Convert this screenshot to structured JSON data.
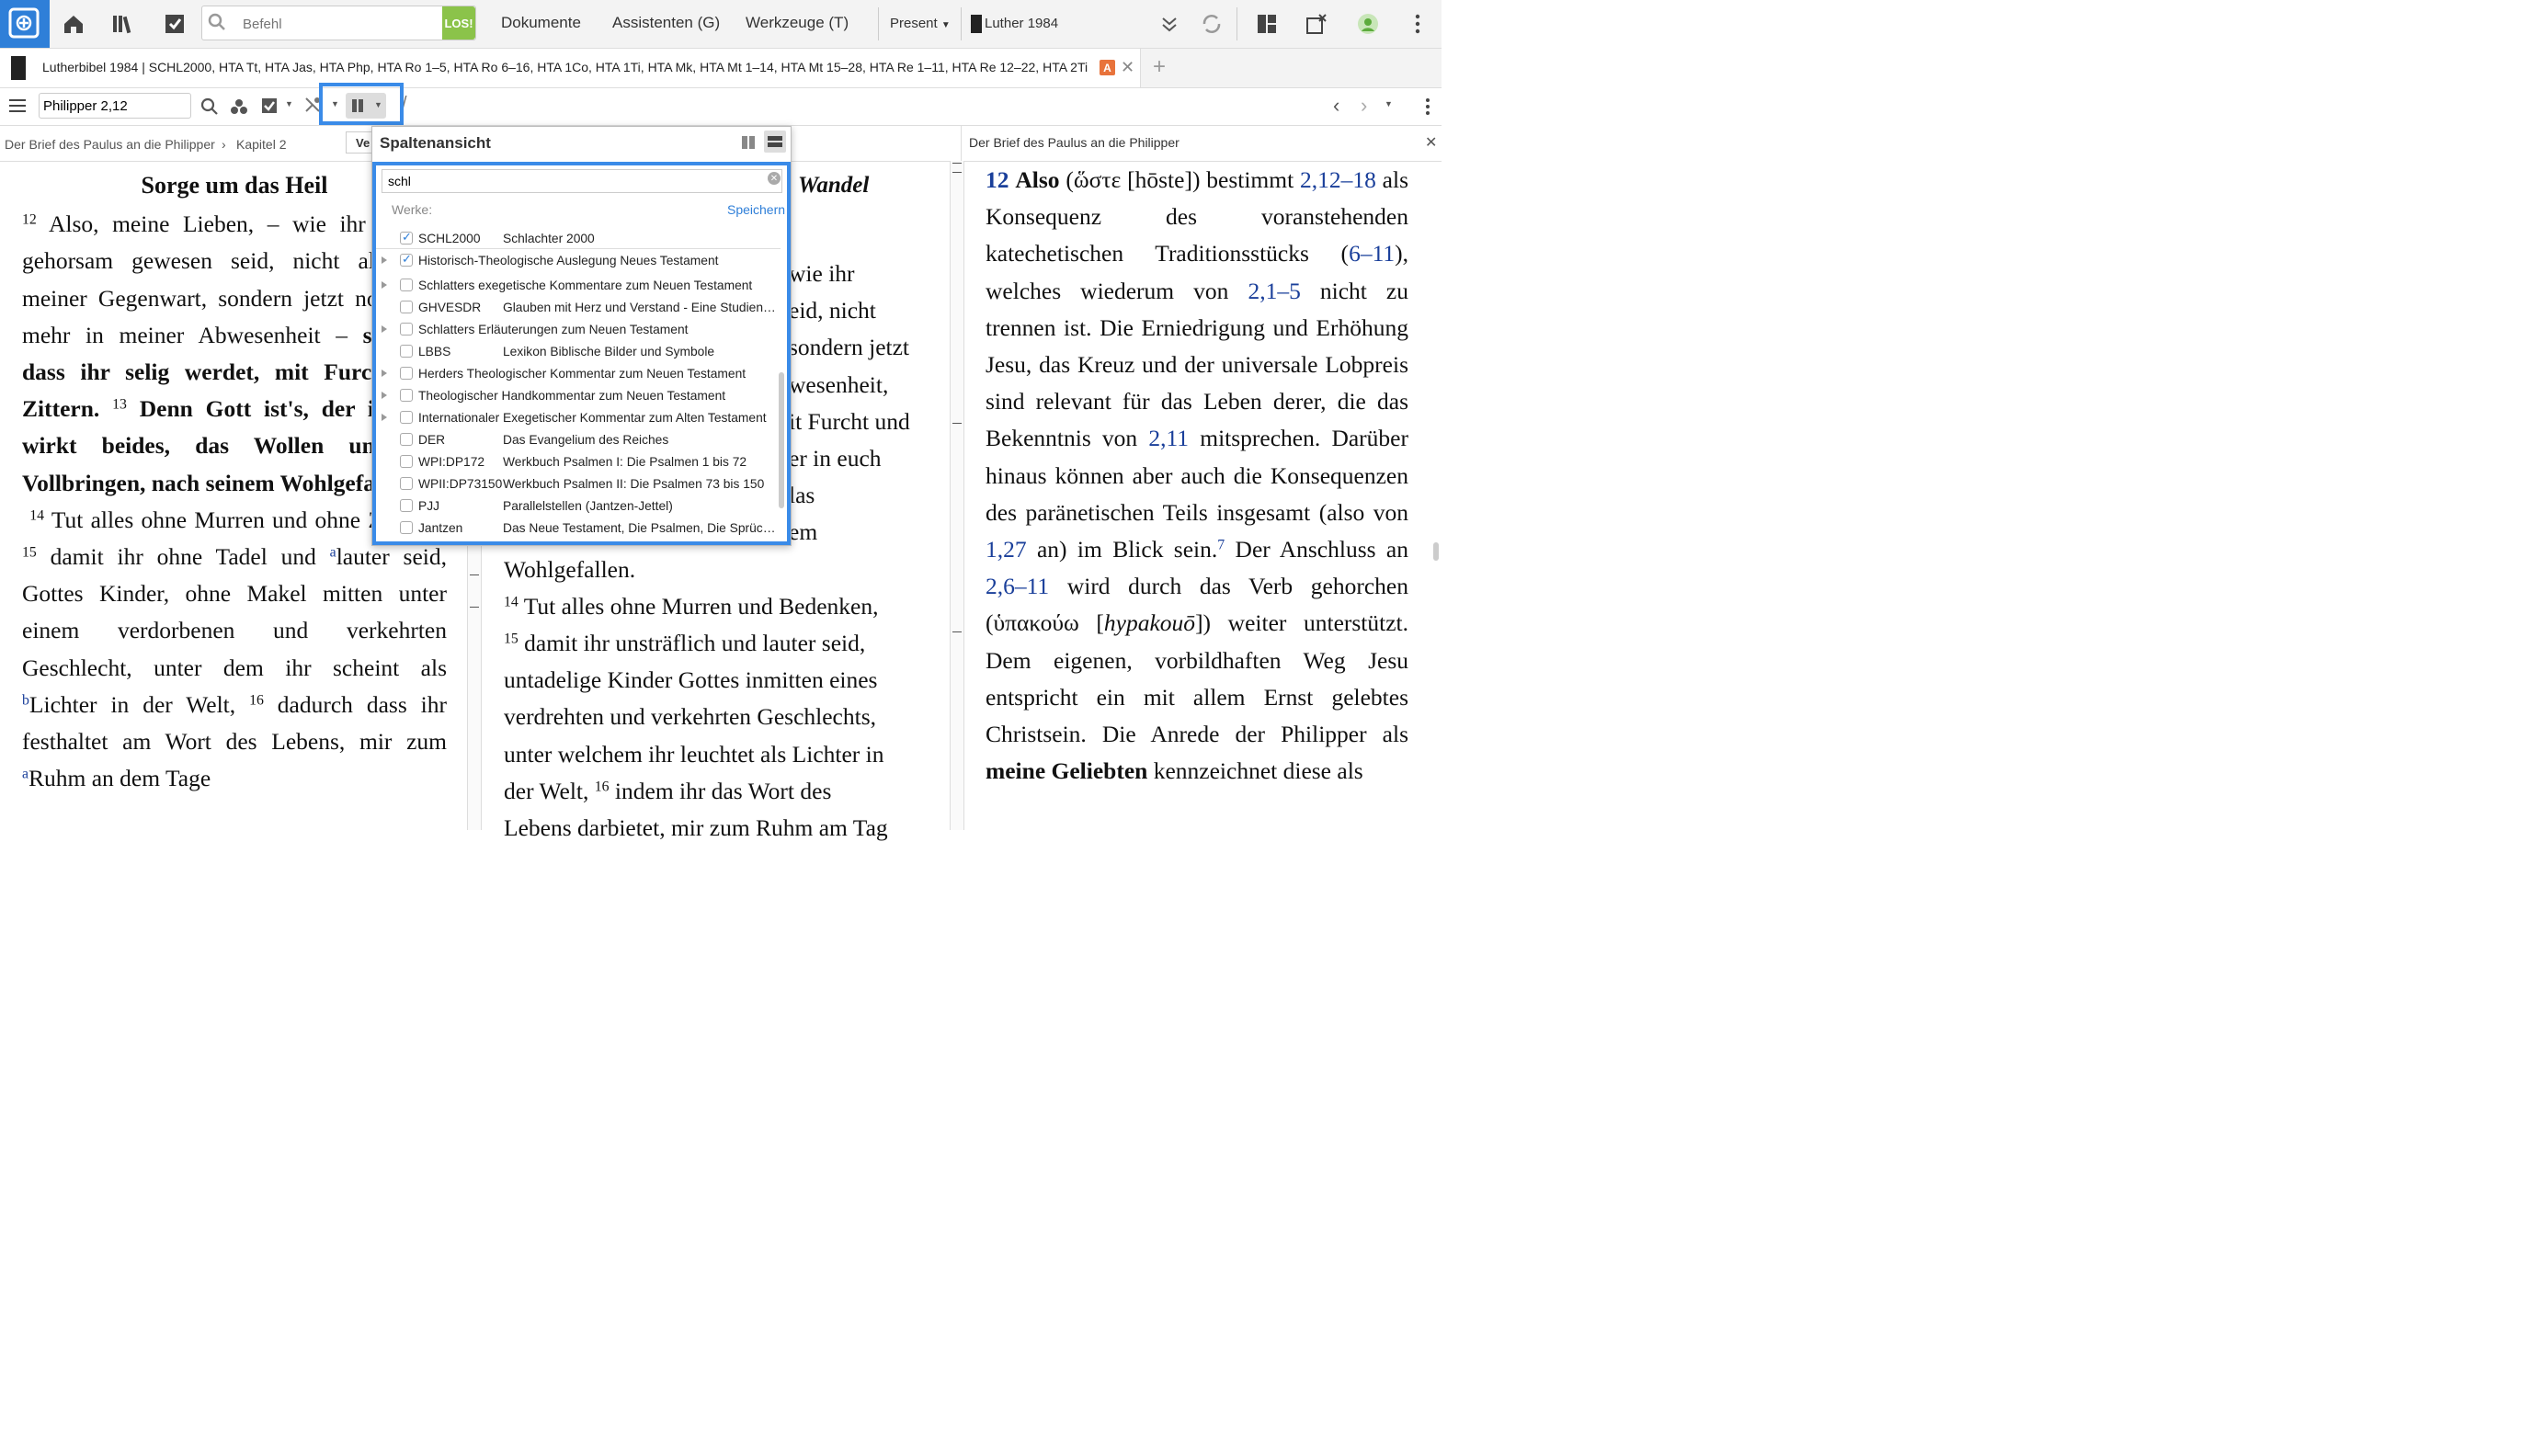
{
  "topbar": {
    "command_placeholder": "Befehl",
    "go_label": "LOS!",
    "menu": [
      "Dokumente",
      "Assistenten (G)",
      "Werkzeuge (T)"
    ],
    "present_label": "Present",
    "resource_label": "Luther 1984"
  },
  "tab": {
    "title": "Lutherbibel 1984 | SCHL2000, HTA Tt, HTA Jas, HTA Php, HTA Ro 1–5, HTA Ro 6–16, HTA 1Co, HTA 1Ti, HTA Mk, HTA Mt 1–14, HTA Mt 15–28, HTA Re 1–11, HTA Re 12–22, HTA 2Ti",
    "badge": "A"
  },
  "toolbar": {
    "reference": "Philipper 2,12"
  },
  "breadcrumb": {
    "left": "Der Brief des Paulus an die Philipper",
    "left_chapter": "Kapitel 2",
    "mid_stub": "Ve",
    "right": "Der Brief des Paulus an die Philipper"
  },
  "popup": {
    "title": "Spaltenansicht",
    "search_value": "schl",
    "works_label": "Werke:",
    "save_label": "Speichern",
    "items": [
      {
        "abbr": "SCHL2000",
        "name": "Schlachter 2000",
        "checked": true,
        "expand": false
      },
      {
        "abbr": "",
        "name": "Historisch-Theologische Auslegung Neues Testament",
        "checked": true,
        "expand": true
      },
      {
        "abbr": "",
        "name": "Schlatters exegetische Kommentare zum Neuen Testament",
        "checked": false,
        "expand": true
      },
      {
        "abbr": "GHVESDR",
        "name": "Glauben mit Herz und Verstand - Eine Studienr…",
        "checked": false,
        "expand": false
      },
      {
        "abbr": "",
        "name": "Schlatters Erläuterungen zum Neuen Testament",
        "checked": false,
        "expand": true
      },
      {
        "abbr": "LBBS",
        "name": "Lexikon Biblische Bilder und Symbole",
        "checked": false,
        "expand": false
      },
      {
        "abbr": "",
        "name": "Herders Theologischer Kommentar zum Neuen Testament",
        "checked": false,
        "expand": true
      },
      {
        "abbr": "",
        "name": "Theologischer Handkommentar zum Neuen Testament",
        "checked": false,
        "expand": true
      },
      {
        "abbr": "",
        "name": "Internationaler Exegetischer Kommentar zum Alten Testament",
        "checked": false,
        "expand": true
      },
      {
        "abbr": "DER",
        "name": "Das Evangelium des Reiches",
        "checked": false,
        "expand": false
      },
      {
        "abbr": "WPI:DP172",
        "name": "Werkbuch Psalmen I: Die Psalmen 1 bis 72",
        "checked": false,
        "expand": false
      },
      {
        "abbr": "WPII:DP73150",
        "name": "Werkbuch Psalmen II: Die Psalmen 73 bis 150",
        "checked": false,
        "expand": false
      },
      {
        "abbr": "PJJ",
        "name": "Parallelstellen (Jantzen-Jettel)",
        "checked": false,
        "expand": false
      },
      {
        "abbr": "Jantzen",
        "name": "Das Neue Testament, Die Psalmen, Die Sprüch…",
        "checked": false,
        "expand": false
      }
    ]
  },
  "pane1": {
    "heading": "Sorge um das Heil"
  },
  "pane2": {
    "heading_fragment": "Wandel"
  }
}
